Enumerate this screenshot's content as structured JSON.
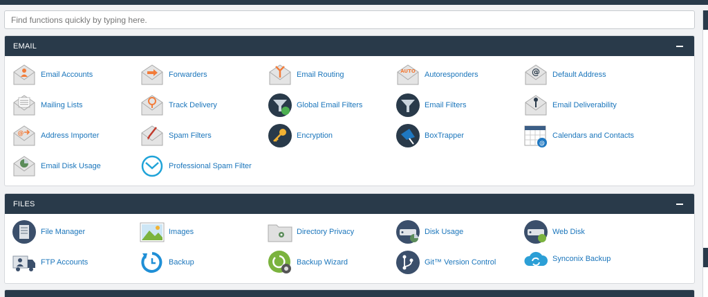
{
  "search": {
    "placeholder": "Find functions quickly by typing here."
  },
  "sections": [
    {
      "title": "EMAIL",
      "items": [
        {
          "label": "Email Accounts",
          "icon": "email-accounts-icon"
        },
        {
          "label": "Forwarders",
          "icon": "forwarders-icon"
        },
        {
          "label": "Email Routing",
          "icon": "email-routing-icon"
        },
        {
          "label": "Autoresponders",
          "icon": "autoresponders-icon"
        },
        {
          "label": "Default Address",
          "icon": "default-address-icon"
        },
        {
          "label": "Mailing Lists",
          "icon": "mailing-lists-icon"
        },
        {
          "label": "Track Delivery",
          "icon": "track-delivery-icon"
        },
        {
          "label": "Global Email Filters",
          "icon": "global-email-filters-icon"
        },
        {
          "label": "Email Filters",
          "icon": "email-filters-icon"
        },
        {
          "label": "Email Deliverability",
          "icon": "email-deliverability-icon"
        },
        {
          "label": "Address Importer",
          "icon": "address-importer-icon"
        },
        {
          "label": "Spam Filters",
          "icon": "spam-filters-icon"
        },
        {
          "label": "Encryption",
          "icon": "encryption-icon"
        },
        {
          "label": "BoxTrapper",
          "icon": "boxtrapper-icon"
        },
        {
          "label": "Calendars and Contacts",
          "icon": "calendars-contacts-icon"
        },
        {
          "label": "Email Disk Usage",
          "icon": "email-disk-usage-icon"
        },
        {
          "label": "Professional Spam Filter",
          "icon": "professional-spam-filter-icon"
        }
      ]
    },
    {
      "title": "FILES",
      "items": [
        {
          "label": "File Manager",
          "icon": "file-manager-icon"
        },
        {
          "label": "Images",
          "icon": "images-icon"
        },
        {
          "label": "Directory Privacy",
          "icon": "directory-privacy-icon"
        },
        {
          "label": "Disk Usage",
          "icon": "disk-usage-icon"
        },
        {
          "label": "Web Disk",
          "icon": "web-disk-icon"
        },
        {
          "label": "FTP Accounts",
          "icon": "ftp-accounts-icon"
        },
        {
          "label": "Backup",
          "icon": "backup-icon"
        },
        {
          "label": "Backup Wizard",
          "icon": "backup-wizard-icon"
        },
        {
          "label": "Git™ Version Control",
          "icon": "git-version-control-icon"
        },
        {
          "label": "Synconix Backup",
          "icon": "synconix-backup-icon"
        }
      ]
    }
  ]
}
